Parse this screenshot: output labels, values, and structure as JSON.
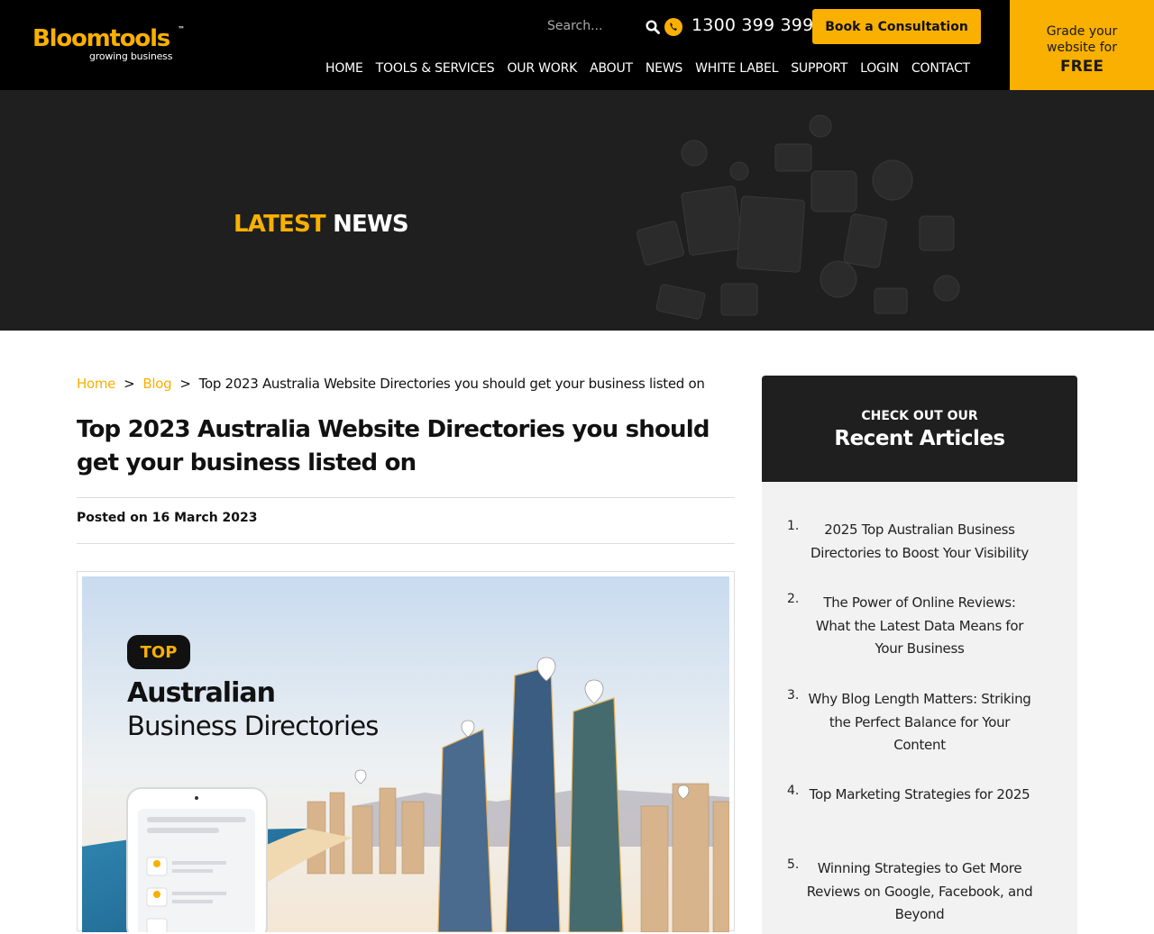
{
  "header": {
    "logo_name": "Bloomtools",
    "logo_tm": "™",
    "logo_tagline": "growing business",
    "search_placeholder": "Search...",
    "phone": "1300 399 399",
    "book_label": "Book a Consultation",
    "nav": [
      "HOME",
      "TOOLS & SERVICES",
      "OUR WORK",
      "ABOUT",
      "NEWS",
      "WHITE LABEL",
      "SUPPORT",
      "LOGIN",
      "CONTACT"
    ],
    "grade_line1": "Grade your",
    "grade_line2": "website for",
    "grade_line3": "FREE"
  },
  "hero": {
    "title_accent": "LATEST",
    "title_rest": "NEWS"
  },
  "breadcrumb": {
    "home": "Home",
    "sep": ">",
    "blog": "Blog",
    "current": "Top 2023 Australia Website Directories you should get your business listed on"
  },
  "article": {
    "title": "Top 2023 Australia Website Directories you should get your business listed on",
    "posted": "Posted on 16 March 2023",
    "image_badge": "TOP",
    "image_line1": "Australian",
    "image_line2": "Business Directories"
  },
  "sidebar": {
    "kicker": "CHECK OUT OUR",
    "title": "Recent Articles",
    "items": [
      {
        "num": "1.",
        "text": "2025 Top Australian Business Directories to Boost Your Visibility"
      },
      {
        "num": "2.",
        "text": "The Power of Online Reviews: What the Latest Data Means for Your Business"
      },
      {
        "num": "3.",
        "text": "Why Blog Length Matters: Striking the Perfect Balance for Your Content"
      },
      {
        "num": "4.",
        "text": "Top Marketing Strategies for 2025"
      },
      {
        "num": "5.",
        "text": "Winning Strategies to Get More Reviews on Google, Facebook, and Beyond"
      }
    ]
  },
  "colors": {
    "brand": "#f9b000",
    "dark": "#1f1f1f",
    "black": "#000000"
  }
}
